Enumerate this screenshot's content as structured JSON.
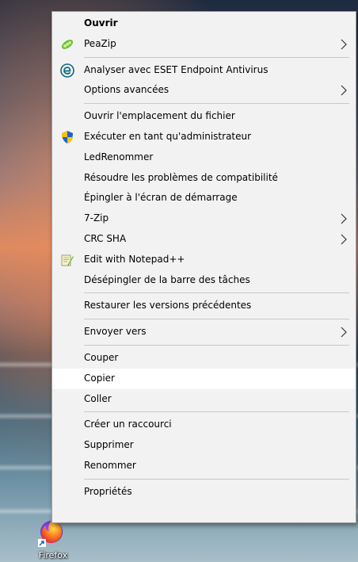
{
  "desktop": {
    "icon_label": "Firefox"
  },
  "menu": {
    "items": [
      {
        "label": "Ouvrir",
        "bold": true
      },
      {
        "label": "PeaZip",
        "icon": "peazip-icon",
        "submenu": true
      },
      {
        "sep": true
      },
      {
        "label": "Analyser avec ESET Endpoint Antivirus",
        "icon": "eset-icon"
      },
      {
        "label": "Options avancées",
        "submenu": true
      },
      {
        "sep": true
      },
      {
        "label": "Ouvrir l'emplacement du fichier"
      },
      {
        "label": "Exécuter en tant qu'administrateur",
        "icon": "uac-shield-icon"
      },
      {
        "label": "LedRenommer"
      },
      {
        "label": "Résoudre les problèmes de compatibilité"
      },
      {
        "label": "Épingler à l'écran de démarrage"
      },
      {
        "label": "7-Zip",
        "submenu": true
      },
      {
        "label": "CRC SHA",
        "submenu": true
      },
      {
        "label": "Edit with Notepad++",
        "icon": "notepad-plus-plus-icon"
      },
      {
        "label": "Désépingler de la barre des tâches"
      },
      {
        "sep": true
      },
      {
        "label": "Restaurer les versions précédentes"
      },
      {
        "sep": true
      },
      {
        "label": "Envoyer vers",
        "submenu": true
      },
      {
        "sep": true
      },
      {
        "label": "Couper"
      },
      {
        "label": "Copier",
        "highlighted": true
      },
      {
        "label": "Coller"
      },
      {
        "sep": true
      },
      {
        "label": "Créer un raccourci"
      },
      {
        "label": "Supprimer"
      },
      {
        "label": "Renommer"
      },
      {
        "sep": true
      },
      {
        "label": "Propriétés"
      }
    ]
  },
  "colors": {
    "menu_bg": "#f2f2f2",
    "highlight_bg": "#ffffff",
    "separator": "#c8c8c8"
  }
}
